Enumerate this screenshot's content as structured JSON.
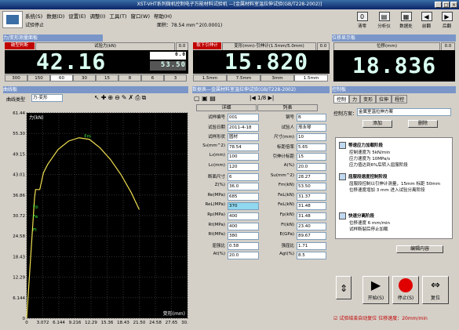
{
  "window": {
    "title": "XST-VHT系列微机控制电子万能材料试验机 —[金属材料室温拉伸试验(GB/T228-2002)]",
    "controls": [
      "_",
      "□",
      "×"
    ]
  },
  "menu": [
    "系统(S)",
    "数据(D)",
    "设置(E)",
    "调整(I)",
    "工具(T)",
    "窗口(W)",
    "帮助(H)"
  ],
  "status": {
    "left": "试验停止",
    "formula": "面积：78.54 mm^2(0.0001)"
  },
  "toolbar_right": [
    {
      "label": "清零",
      "icon": "zero-icon"
    },
    {
      "label": "分析仪",
      "icon": "analyzer-icon"
    },
    {
      "label": "数据处",
      "icon": "data-icon"
    },
    {
      "label": "前翻",
      "icon": "prev-icon"
    },
    {
      "label": "后翻",
      "icon": "next-icon"
    }
  ],
  "panels": {
    "force": {
      "head": "力/变形测量面板",
      "tab_label": "试验力(kN)",
      "tab_right": "0.0",
      "big_value": "42.16",
      "small_top": "0.0",
      "small_value": "53.50",
      "rates": [
        "300",
        "150",
        "60",
        "30",
        "15",
        "8",
        "6",
        "3"
      ]
    },
    "strain": {
      "head": "",
      "tab_label": "变形(mm)-引伸计(1.5mm/5.0mm)",
      "tab_right": "0.0",
      "big_value": "15.820",
      "speeds": [
        "1.5mm",
        "7.5mm",
        "3mm",
        "1.5mm"
      ]
    },
    "disp": {
      "head": "位移显示板",
      "tab_label": "位移(mm)",
      "tab_right": "0.0",
      "big_value": "18.836"
    }
  },
  "curve": {
    "head": "曲线板",
    "type_label": "曲线类型",
    "type_value": "力-变形"
  },
  "chart_data": {
    "type": "line",
    "ylabel": "力(kN)",
    "xlabel": "变形(mm)",
    "yticks": [
      "0",
      "6.144",
      "12.29",
      "18.43",
      "24.58",
      "30.72",
      "36.86",
      "43.01",
      "49.15",
      "55.30",
      "61.44"
    ],
    "xticks": [
      "0",
      "3.072",
      "6.144",
      "9.216",
      "12.29",
      "15.36",
      "18.43",
      "21.50",
      "24.58",
      "27.65",
      "30.72"
    ],
    "ylim": [
      0,
      61.44
    ],
    "xlim": [
      0,
      30.72
    ],
    "x": [
      0,
      1.5,
      1.7,
      2.5,
      3.2,
      4,
      6,
      8,
      10,
      12,
      14,
      16,
      18,
      20,
      21.5
    ],
    "y": [
      0,
      36.0,
      38.5,
      38.5,
      43.5,
      46,
      50.5,
      53,
      54,
      53.5,
      51,
      47.5,
      43,
      37.5,
      32.5
    ],
    "annotations": [
      "Fp",
      "Fe",
      "Fl",
      "Fm"
    ]
  },
  "table": {
    "head": "数据表—金属材料室温拉伸试验(GB/T228-2002)",
    "page": "1/8",
    "col1": "详细",
    "col2": "列表",
    "rows": [
      {
        "l": "试样编号",
        "v": "001",
        "l2": "钢号",
        "v2": "B"
      },
      {
        "l": "试验日期",
        "v": "2011-4-18",
        "l2": "试验人",
        "v2": "邢永琴"
      },
      {
        "l": "试样形状",
        "v": "圆材",
        "l2": "尺寸(mm)",
        "v2": "10"
      },
      {
        "l": "S₀(mm^2)",
        "v": "78.54",
        "l2": "标距倍率",
        "v2": "5.65"
      },
      {
        "l": "L₀(mm)",
        "v": "100",
        "l2": "引伸计标距",
        "v2": "15"
      },
      {
        "l": "Lc(mm)",
        "v": "120",
        "l2": "A(%)",
        "v2": "20.0"
      },
      {
        "l": "断面尺寸",
        "v": "6",
        "l2": "Su(mm^2)",
        "v2": "28.27"
      },
      {
        "l": "Z(%)",
        "v": "36.0",
        "l2": "Fm(kN)",
        "v2": "53.50"
      },
      {
        "l": "Re(MPa)",
        "v": "685",
        "l2": "FeL(kN)",
        "v2": "31.37"
      },
      {
        "l": "ReL(MPa)",
        "v": "370",
        "l2": "FeL(kN)",
        "v2": "31.48"
      },
      {
        "l": "Rp(MPa)",
        "v": "400",
        "l2": "Fp(kN)",
        "v2": "31.48"
      },
      {
        "l": "Rt(MPa)",
        "v": "400",
        "l2": "Ft(kN)",
        "v2": "23.40"
      },
      {
        "l": "Rt(MPa)",
        "v": "380",
        "l2": "E(GPa)",
        "v2": "89.67"
      },
      {
        "l": "屈强比",
        "v": "0.58",
        "l2": "强屈比",
        "v2": "1.71"
      },
      {
        "l": "At(%)",
        "v": "20.0",
        "l2": "Agt(%)",
        "v2": "8.5"
      }
    ]
  },
  "control": {
    "head": "控制板",
    "tabs": [
      "控制",
      "力",
      "变形",
      "拉伸",
      "程控"
    ],
    "plan_label": "控制方案：",
    "plan_value": "金属室温拉伸方案",
    "add": "添加",
    "delete": "删除",
    "edit": "编辑内容",
    "steps": [
      {
        "title": "等速应力加载阶段",
        "lines": [
          "控制速度为 5kN/min",
          "应力速度为 10MPa/s",
          "应力值达到6%后转入屈服阶段"
        ]
      },
      {
        "title": "屈服段速度控制阶段",
        "lines": [
          "屈服段控制以引伸计测量，15mm 标距 50mm",
          "位移速度增加 3 mm 进入试验分离阶段"
        ]
      },
      {
        "title": "快速分离阶段",
        "lines": [
          "位移速度 6 mm/min",
          "试样断裂后停止加载"
        ]
      }
    ],
    "buttons": {
      "start": "开始(S)",
      "stop": "停止(S)",
      "reset": "复位"
    },
    "check": "试验结束自动复位 位移速度：20mm/min"
  }
}
